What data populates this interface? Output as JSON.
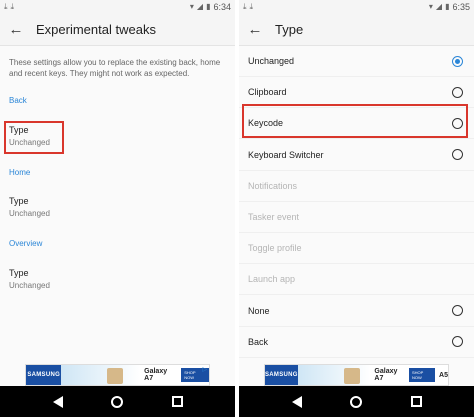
{
  "left": {
    "status": {
      "time": "6:34"
    },
    "app_bar": {
      "title": "Experimental tweaks"
    },
    "description": "These settings allow you to replace the existing back, home and recent keys. They might not work as expected.",
    "sections": [
      {
        "header": "Back",
        "item": {
          "title": "Type",
          "summary": "Unchanged"
        }
      },
      {
        "header": "Home",
        "item": {
          "title": "Type",
          "summary": "Unchanged"
        }
      },
      {
        "header": "Overview",
        "item": {
          "title": "Type",
          "summary": "Unchanged"
        }
      }
    ]
  },
  "right": {
    "status": {
      "time": "6:35"
    },
    "app_bar": {
      "title": "Type"
    },
    "options": [
      {
        "label": "Unchanged",
        "state": "checked"
      },
      {
        "label": "Clipboard",
        "state": "unchecked"
      },
      {
        "label": "Keycode",
        "state": "unchecked"
      },
      {
        "label": "Keyboard Switcher",
        "state": "unchecked"
      },
      {
        "label": "Notifications",
        "state": "disabled"
      },
      {
        "label": "Tasker event",
        "state": "disabled"
      },
      {
        "label": "Toggle profile",
        "state": "disabled"
      },
      {
        "label": "Launch app",
        "state": "disabled"
      },
      {
        "label": "None",
        "state": "unchecked"
      },
      {
        "label": "Back",
        "state": "unchecked"
      }
    ]
  },
  "ad": {
    "brand": "SAMSUNG",
    "model_left": "Galaxy A7",
    "model_right": "A5",
    "cta": "SHOP NOW"
  },
  "colors": {
    "accent": "#2b86d7",
    "highlight_box": "#d9362c",
    "nav_bar": "#000000"
  },
  "icons": {
    "back": "arrow-left-icon",
    "download": "download-icon",
    "wifi": "wifi-icon",
    "signal": "signal-icon",
    "battery": "battery-icon"
  }
}
